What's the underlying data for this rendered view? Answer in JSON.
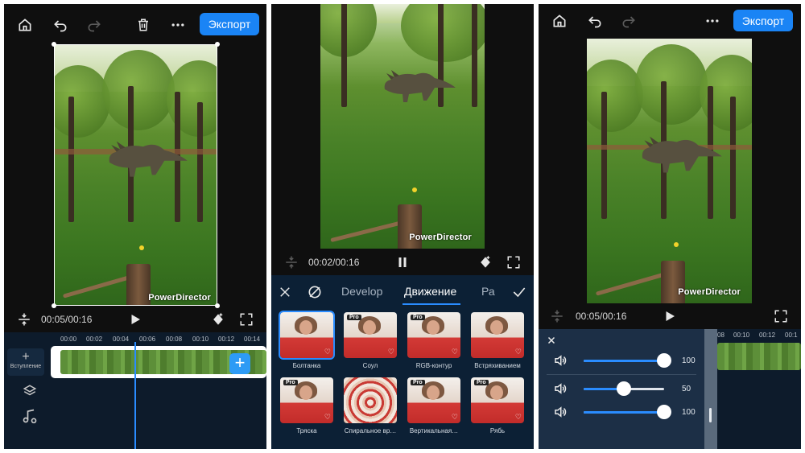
{
  "panels": [
    {
      "export_label": "Экспорт",
      "watermark": "PowerDirector",
      "time": "00:05/00:16",
      "ruler": [
        "00:00",
        "00:02",
        "00:04",
        "00:06",
        "00:08",
        "00:10",
        "00:12",
        "00:14"
      ],
      "intro_label": "Вступление"
    },
    {
      "watermark": "PowerDirector",
      "time": "00:02/00:16",
      "tabs": [
        "Develop",
        "Движение",
        "Ра"
      ],
      "active_tab": "Движение",
      "effects": [
        {
          "label": "Болтанка",
          "pro": false,
          "selected": true
        },
        {
          "label": "Соул",
          "pro": true,
          "selected": false
        },
        {
          "label": "RGB-контур",
          "pro": true,
          "selected": false
        },
        {
          "label": "Встряхиванием",
          "pro": false,
          "selected": false
        },
        {
          "label": "Тряска",
          "pro": true,
          "selected": false
        },
        {
          "label": "Спиральное вр…",
          "pro": false,
          "selected": false
        },
        {
          "label": "Вертикальная…",
          "pro": true,
          "selected": false
        },
        {
          "label": "Рябь",
          "pro": true,
          "selected": false
        }
      ],
      "pro_badge": "Pro"
    },
    {
      "export_label": "Экспорт",
      "watermark": "PowerDirector",
      "time": "00:05/00:16",
      "ruler": [
        "08",
        "00:10",
        "00:12",
        "00:1"
      ],
      "volumes": [
        {
          "value": 100,
          "level": 1.0
        },
        {
          "value": 50,
          "level": 0.5
        },
        {
          "value": 100,
          "level": 1.0
        }
      ]
    }
  ],
  "colors": {
    "accent": "#1a84f5",
    "timeline_bg": "#0d1b2b",
    "panel_bg": "#0f0f0f",
    "audio_panel_bg": "#1c2f46"
  }
}
